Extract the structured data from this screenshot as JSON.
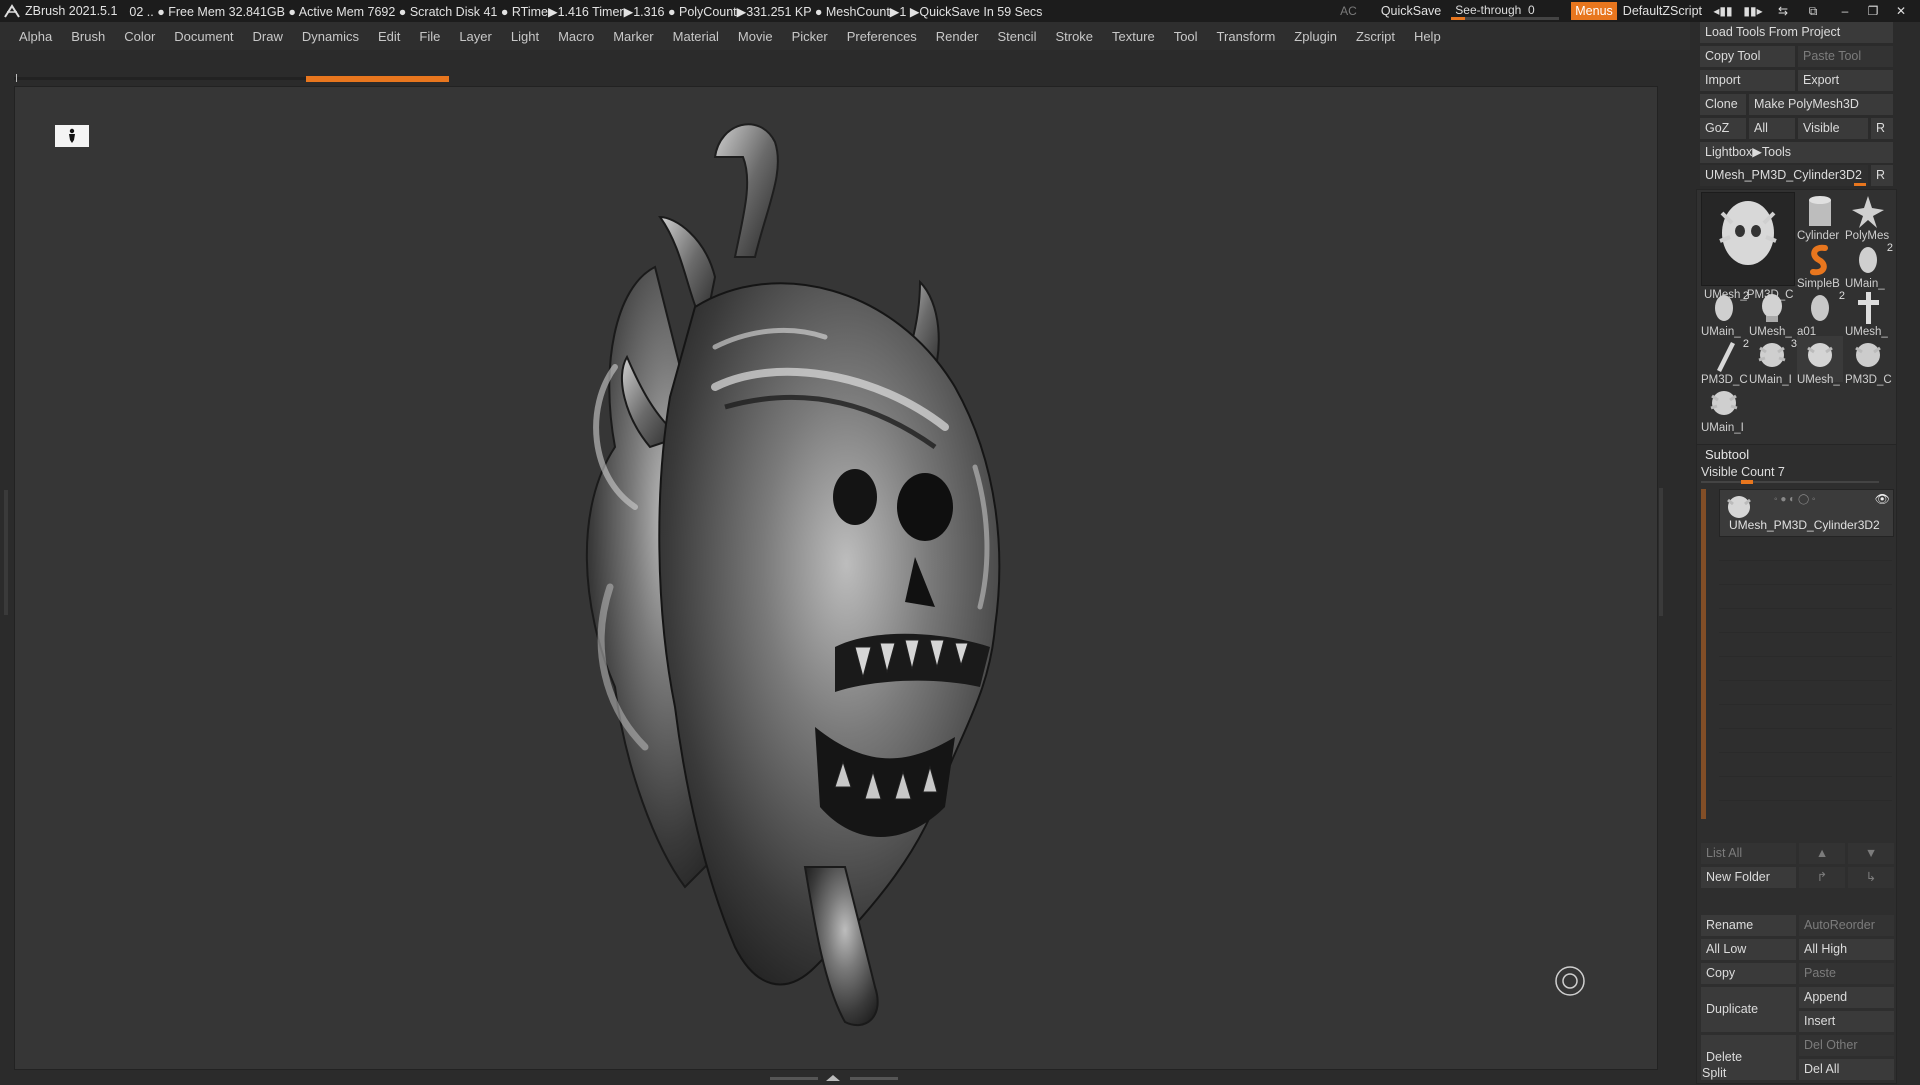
{
  "titlebar": {
    "app": "ZBrush 2021.5.1",
    "status": "02  .. ● Free Mem 32.841GB ● Active Mem 7692 ● Scratch Disk 41 ●  RTime▶1.416 Timer▶1.316 ● PolyCount▶331.251 KP  ● MeshCount▶1  ▶QuickSave In 59 Secs",
    "ac": "AC",
    "quicksave": "QuickSave",
    "see_through_label": "See-through",
    "see_through_value": "0",
    "menus": "Menus",
    "script": "DefaultZScript"
  },
  "menubar": [
    "Alpha",
    "Brush",
    "Color",
    "Document",
    "Draw",
    "Dynamics",
    "Edit",
    "File",
    "Layer",
    "Light",
    "Macro",
    "Marker",
    "Material",
    "Movie",
    "Picker",
    "Preferences",
    "Render",
    "Stencil",
    "Stroke",
    "Texture",
    "Tool",
    "Transform",
    "Zplugin",
    "Zscript",
    "Help"
  ],
  "tool": {
    "load_tools": "Load Tools From Project",
    "copy_tool": "Copy Tool",
    "paste_tool": "Paste Tool",
    "import": "Import",
    "export": "Export",
    "clone": "Clone",
    "make_polymesh": "Make PolyMesh3D",
    "goz": "GoZ",
    "all": "All",
    "visible": "Visible",
    "r": "R",
    "lightbox_tools": "Lightbox▶Tools",
    "current_tool": "UMesh_PM3D_Cylinder3D2",
    "r2": "R",
    "thumbs": [
      {
        "name": "UMesh_PM3D_C",
        "count": ""
      },
      {
        "name": "Cylinder",
        "count": ""
      },
      {
        "name": "PolyMes",
        "count": ""
      },
      {
        "name": "SimpleB",
        "count": ""
      },
      {
        "name": "UMain_",
        "count": "2"
      },
      {
        "name": "UMain_",
        "count": "2"
      },
      {
        "name": "UMesh_",
        "count": ""
      },
      {
        "name": "a01",
        "count": "2"
      },
      {
        "name": "UMesh_",
        "count": ""
      },
      {
        "name": "PM3D_C",
        "count": "2"
      },
      {
        "name": "UMain_I",
        "count": "3"
      },
      {
        "name": "UMesh_",
        "count": ""
      },
      {
        "name": "PM3D_C",
        "count": ""
      },
      {
        "name": "UMain_I",
        "count": ""
      }
    ]
  },
  "subtool": {
    "title": "Subtool",
    "visible_count": "Visible Count 7",
    "item_name": "UMesh_PM3D_Cylinder3D2",
    "list_all": "List All",
    "new_folder": "New Folder",
    "rename": "Rename",
    "auto_reorder": "AutoReorder",
    "all_low": "All Low",
    "all_high": "All High",
    "copy": "Copy",
    "paste": "Paste",
    "duplicate": "Duplicate",
    "append": "Append",
    "insert": "Insert",
    "delete": "Delete",
    "del_other": "Del Other",
    "del_all": "Del All",
    "split": "Split"
  },
  "colors": {
    "accent": "#e8761e",
    "bg": "#2b2b2b",
    "canvas": "#363636"
  }
}
